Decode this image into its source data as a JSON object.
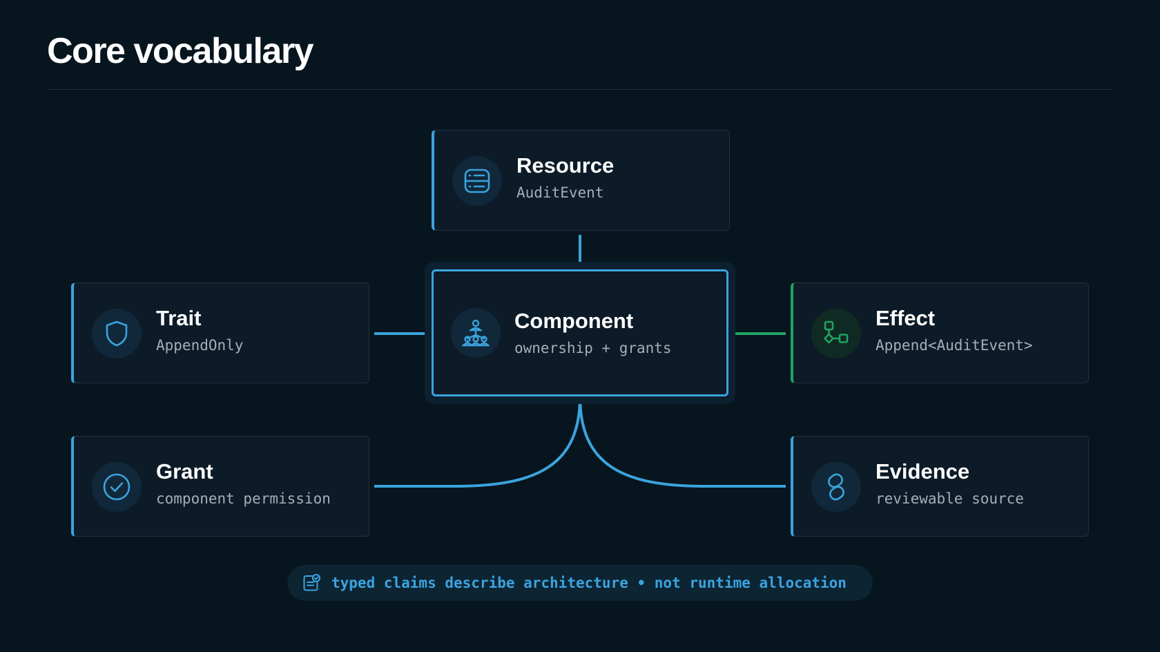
{
  "title": "Core vocabulary",
  "colors": {
    "background": "#07151e",
    "accent_blue": "#3ba4de",
    "accent_green": "#20a463",
    "card": "#0c1b27"
  },
  "nodes": {
    "resource": {
      "title": "Resource",
      "subtitle": "AuditEvent",
      "icon": "server-icon"
    },
    "component": {
      "title": "Component",
      "subtitle": "ownership + grants",
      "icon": "hierarchy-icon"
    },
    "trait": {
      "title": "Trait",
      "subtitle": "AppendOnly",
      "icon": "shield-icon"
    },
    "effect": {
      "title": "Effect",
      "subtitle": "Append<AuditEvent>",
      "icon": "workflow-icon"
    },
    "grant": {
      "title": "Grant",
      "subtitle": "component permission",
      "icon": "check-circle-icon"
    },
    "evidence": {
      "title": "Evidence",
      "subtitle": "reviewable source",
      "icon": "link-icon"
    }
  },
  "edges": [
    {
      "from": "component",
      "to": "resource"
    },
    {
      "from": "component",
      "to": "trait"
    },
    {
      "from": "component",
      "to": "effect"
    },
    {
      "from": "component",
      "to": "grant"
    },
    {
      "from": "component",
      "to": "evidence"
    }
  ],
  "footer": {
    "text": "typed claims describe architecture • not runtime allocation",
    "icon": "document-check-icon"
  }
}
